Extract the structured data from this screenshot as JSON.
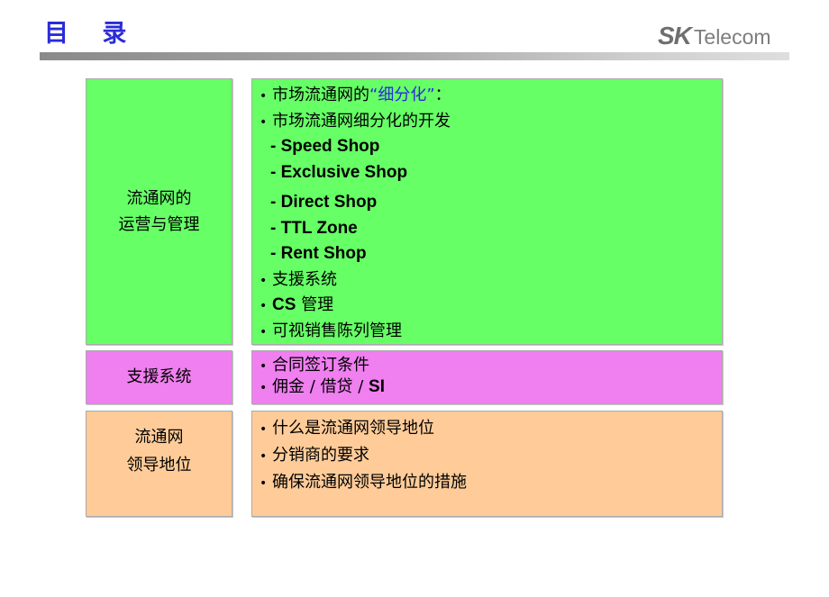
{
  "header": {
    "title": "目 录",
    "logo": {
      "sk": "SK",
      "telecom": "Telecom"
    }
  },
  "colors": {
    "title": "#2b2bd9",
    "green": "#66ff66",
    "pink": "#f07ff0",
    "orange": "#ffcc99",
    "highlight": "#2b2bd9"
  },
  "sections": [
    {
      "label_lines": [
        "流通网的",
        "运营与管理"
      ],
      "items": [
        {
          "type": "bullet",
          "text": "市场流通网的",
          "highlight": "“细分化”",
          "suffix": "："
        },
        {
          "type": "bullet",
          "text": "市场流通网细分化的开发"
        },
        {
          "type": "sub",
          "text": "- Speed Shop"
        },
        {
          "type": "sub",
          "text": "- Exclusive Shop"
        },
        {
          "type": "sub",
          "text": "- Direct Shop"
        },
        {
          "type": "sub",
          "text": "- TTL Zone"
        },
        {
          "type": "sub",
          "text": "-  Rent Shop"
        },
        {
          "type": "bullet",
          "text": "支援系统"
        },
        {
          "type": "bullet",
          "prefix_en": "CS",
          "text": " 管理"
        },
        {
          "type": "bullet",
          "text": "可视销售陈列管理"
        }
      ]
    },
    {
      "label_lines": [
        "支援系统"
      ],
      "items": [
        {
          "type": "bullet",
          "text": "合同签订条件"
        },
        {
          "type": "bullet",
          "text": "佣金 / 借贷 / ",
          "suffix_en": "SI"
        }
      ]
    },
    {
      "label_lines": [
        "流通网",
        "领导地位"
      ],
      "items": [
        {
          "type": "bullet",
          "text": "什么是流通网领导地位"
        },
        {
          "type": "bullet",
          "text": "分销商的要求"
        },
        {
          "type": "bullet",
          "text": "确保流通网领导地位的措施"
        }
      ]
    }
  ],
  "bullet_char": "•"
}
